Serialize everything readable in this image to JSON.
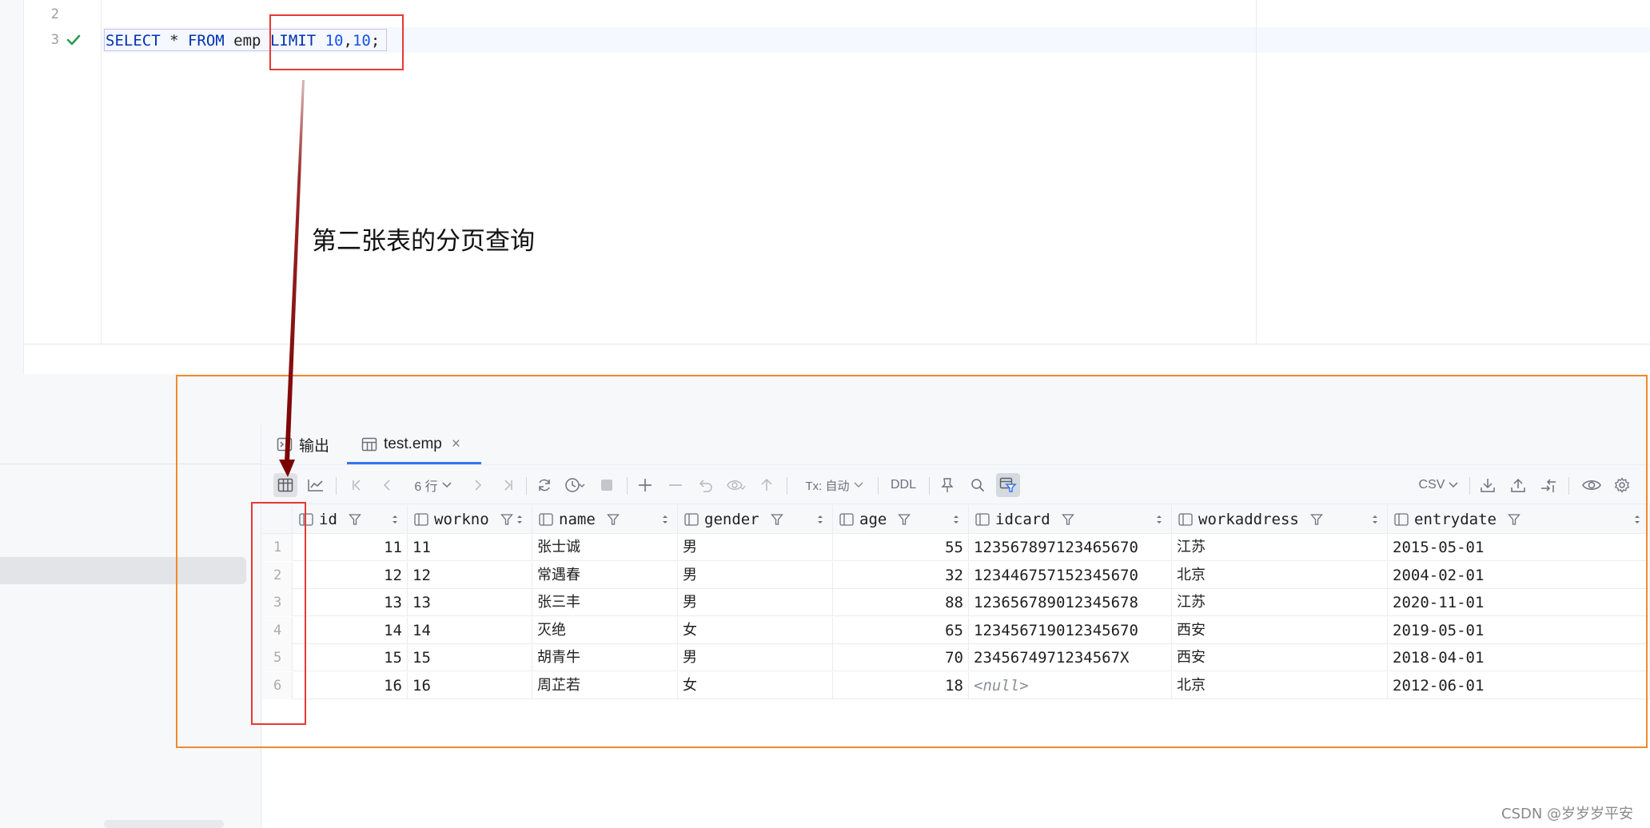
{
  "editor": {
    "lines": [
      {
        "number": "2",
        "code": ""
      },
      {
        "number": "3",
        "status_icon": "check-icon",
        "code_parts": [
          {
            "text": "SELECT",
            "cls": "kw"
          },
          {
            "text": " * ",
            "cls": ""
          },
          {
            "text": "FROM",
            "cls": "kw"
          },
          {
            "text": " emp ",
            "cls": ""
          },
          {
            "text": "LIMIT",
            "cls": "kw"
          },
          {
            "text": " ",
            "cls": ""
          },
          {
            "text": "10",
            "cls": "num"
          },
          {
            "text": ",",
            "cls": ""
          },
          {
            "text": "10",
            "cls": "num"
          },
          {
            "text": ";",
            "cls": ""
          }
        ]
      }
    ]
  },
  "annotation": {
    "text": "第二张表的分页查询"
  },
  "tabs": [
    {
      "label": "输出",
      "icon": "console-icon"
    },
    {
      "label": "test.emp",
      "icon": "table-icon",
      "active": true,
      "close": "×"
    }
  ],
  "toolbar": {
    "row_count": "6 行",
    "tx_mode": "Tx: 自动",
    "ddl": "DDL",
    "export_format": "CSV"
  },
  "grid": {
    "columns": [
      "id",
      "workno",
      "name",
      "gender",
      "age",
      "idcard",
      "workaddress",
      "entrydate"
    ],
    "rows": [
      {
        "n": "1",
        "id": "11",
        "workno": "11",
        "name": "张士诚",
        "gender": "男",
        "age": "55",
        "idcard": "123567897123465670",
        "workaddress": "江苏",
        "entrydate": "2015-05-01"
      },
      {
        "n": "2",
        "id": "12",
        "workno": "12",
        "name": "常遇春",
        "gender": "男",
        "age": "32",
        "idcard": "123446757152345670",
        "workaddress": "北京",
        "entrydate": "2004-02-01"
      },
      {
        "n": "3",
        "id": "13",
        "workno": "13",
        "name": "张三丰",
        "gender": "男",
        "age": "88",
        "idcard": "123656789012345678",
        "workaddress": "江苏",
        "entrydate": "2020-11-01"
      },
      {
        "n": "4",
        "id": "14",
        "workno": "14",
        "name": "灭绝",
        "gender": "女",
        "age": "65",
        "idcard": "123456719012345670",
        "workaddress": "西安",
        "entrydate": "2019-05-01"
      },
      {
        "n": "5",
        "id": "15",
        "workno": "15",
        "name": "胡青牛",
        "gender": "男",
        "age": "70",
        "idcard": "2345674971234567X",
        "workaddress": "西安",
        "entrydate": "2018-04-01"
      },
      {
        "n": "6",
        "id": "16",
        "workno": "16",
        "name": "周芷若",
        "gender": "女",
        "age": "18",
        "idcard": "<null>",
        "workaddress": "北京",
        "entrydate": "2012-06-01"
      }
    ]
  },
  "watermark": "CSDN @岁岁岁平安",
  "colors": {
    "accent": "#3574f0",
    "annotation_red": "#e53935",
    "annotation_orange": "#f08a2c",
    "keyword": "#0033b3",
    "number": "#1750eb"
  }
}
